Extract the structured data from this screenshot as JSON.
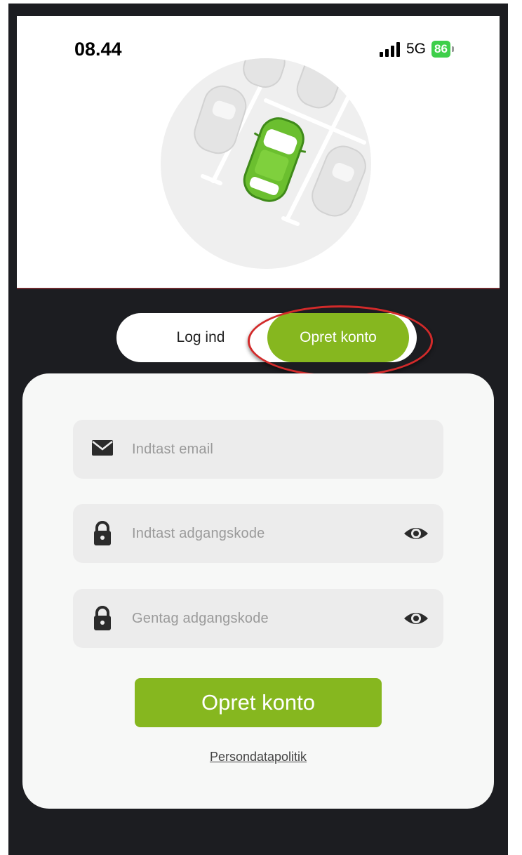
{
  "status_bar": {
    "time": "08.44",
    "network": "5G",
    "battery": "86"
  },
  "auth_tabs": {
    "login_label": "Log ind",
    "signup_label": "Opret konto",
    "active": "signup"
  },
  "form": {
    "email_placeholder": "Indtast email",
    "password_placeholder": "Indtast adgangskode",
    "repeat_password_placeholder": "Gentag adgangskode",
    "submit_label": "Opret konto",
    "privacy_link": "Persondatapolitik"
  },
  "colors": {
    "brand_green": "#86b71f",
    "background_dark": "#1c1d21",
    "annotation_red": "#d22a2a"
  },
  "icons": [
    "signal-icon",
    "battery-icon",
    "parking-car-illustration",
    "envelope-icon",
    "lock-icon",
    "eye-icon"
  ]
}
